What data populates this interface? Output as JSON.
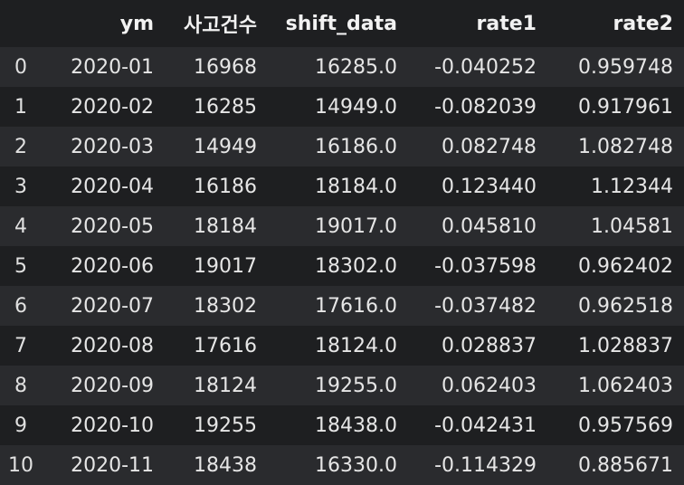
{
  "table": {
    "columns": [
      "",
      "ym",
      "사고건수",
      "shift_data",
      "rate1",
      "rate2"
    ],
    "rows": [
      {
        "index": "0",
        "ym": "2020-01",
        "count": "16968",
        "shift": "16285.0",
        "rate1": "-0.040252",
        "rate2": "0.959748"
      },
      {
        "index": "1",
        "ym": "2020-02",
        "count": "16285",
        "shift": "14949.0",
        "rate1": "-0.082039",
        "rate2": "0.917961"
      },
      {
        "index": "2",
        "ym": "2020-03",
        "count": "14949",
        "shift": "16186.0",
        "rate1": "0.082748",
        "rate2": "1.082748"
      },
      {
        "index": "3",
        "ym": "2020-04",
        "count": "16186",
        "shift": "18184.0",
        "rate1": "0.123440",
        "rate2": "1.12344"
      },
      {
        "index": "4",
        "ym": "2020-05",
        "count": "18184",
        "shift": "19017.0",
        "rate1": "0.045810",
        "rate2": "1.04581"
      },
      {
        "index": "5",
        "ym": "2020-06",
        "count": "19017",
        "shift": "18302.0",
        "rate1": "-0.037598",
        "rate2": "0.962402"
      },
      {
        "index": "6",
        "ym": "2020-07",
        "count": "18302",
        "shift": "17616.0",
        "rate1": "-0.037482",
        "rate2": "0.962518"
      },
      {
        "index": "7",
        "ym": "2020-08",
        "count": "17616",
        "shift": "18124.0",
        "rate1": "0.028837",
        "rate2": "1.028837"
      },
      {
        "index": "8",
        "ym": "2020-09",
        "count": "18124",
        "shift": "19255.0",
        "rate1": "0.062403",
        "rate2": "1.062403"
      },
      {
        "index": "9",
        "ym": "2020-10",
        "count": "19255",
        "shift": "18438.0",
        "rate1": "-0.042431",
        "rate2": "0.957569"
      },
      {
        "index": "10",
        "ym": "2020-11",
        "count": "18438",
        "shift": "16330.0",
        "rate1": "-0.114329",
        "rate2": "0.885671"
      }
    ]
  },
  "colors": {
    "background": "#1e1f21",
    "striped_row": "#2a2b2e",
    "text": "#e6e6e6"
  }
}
